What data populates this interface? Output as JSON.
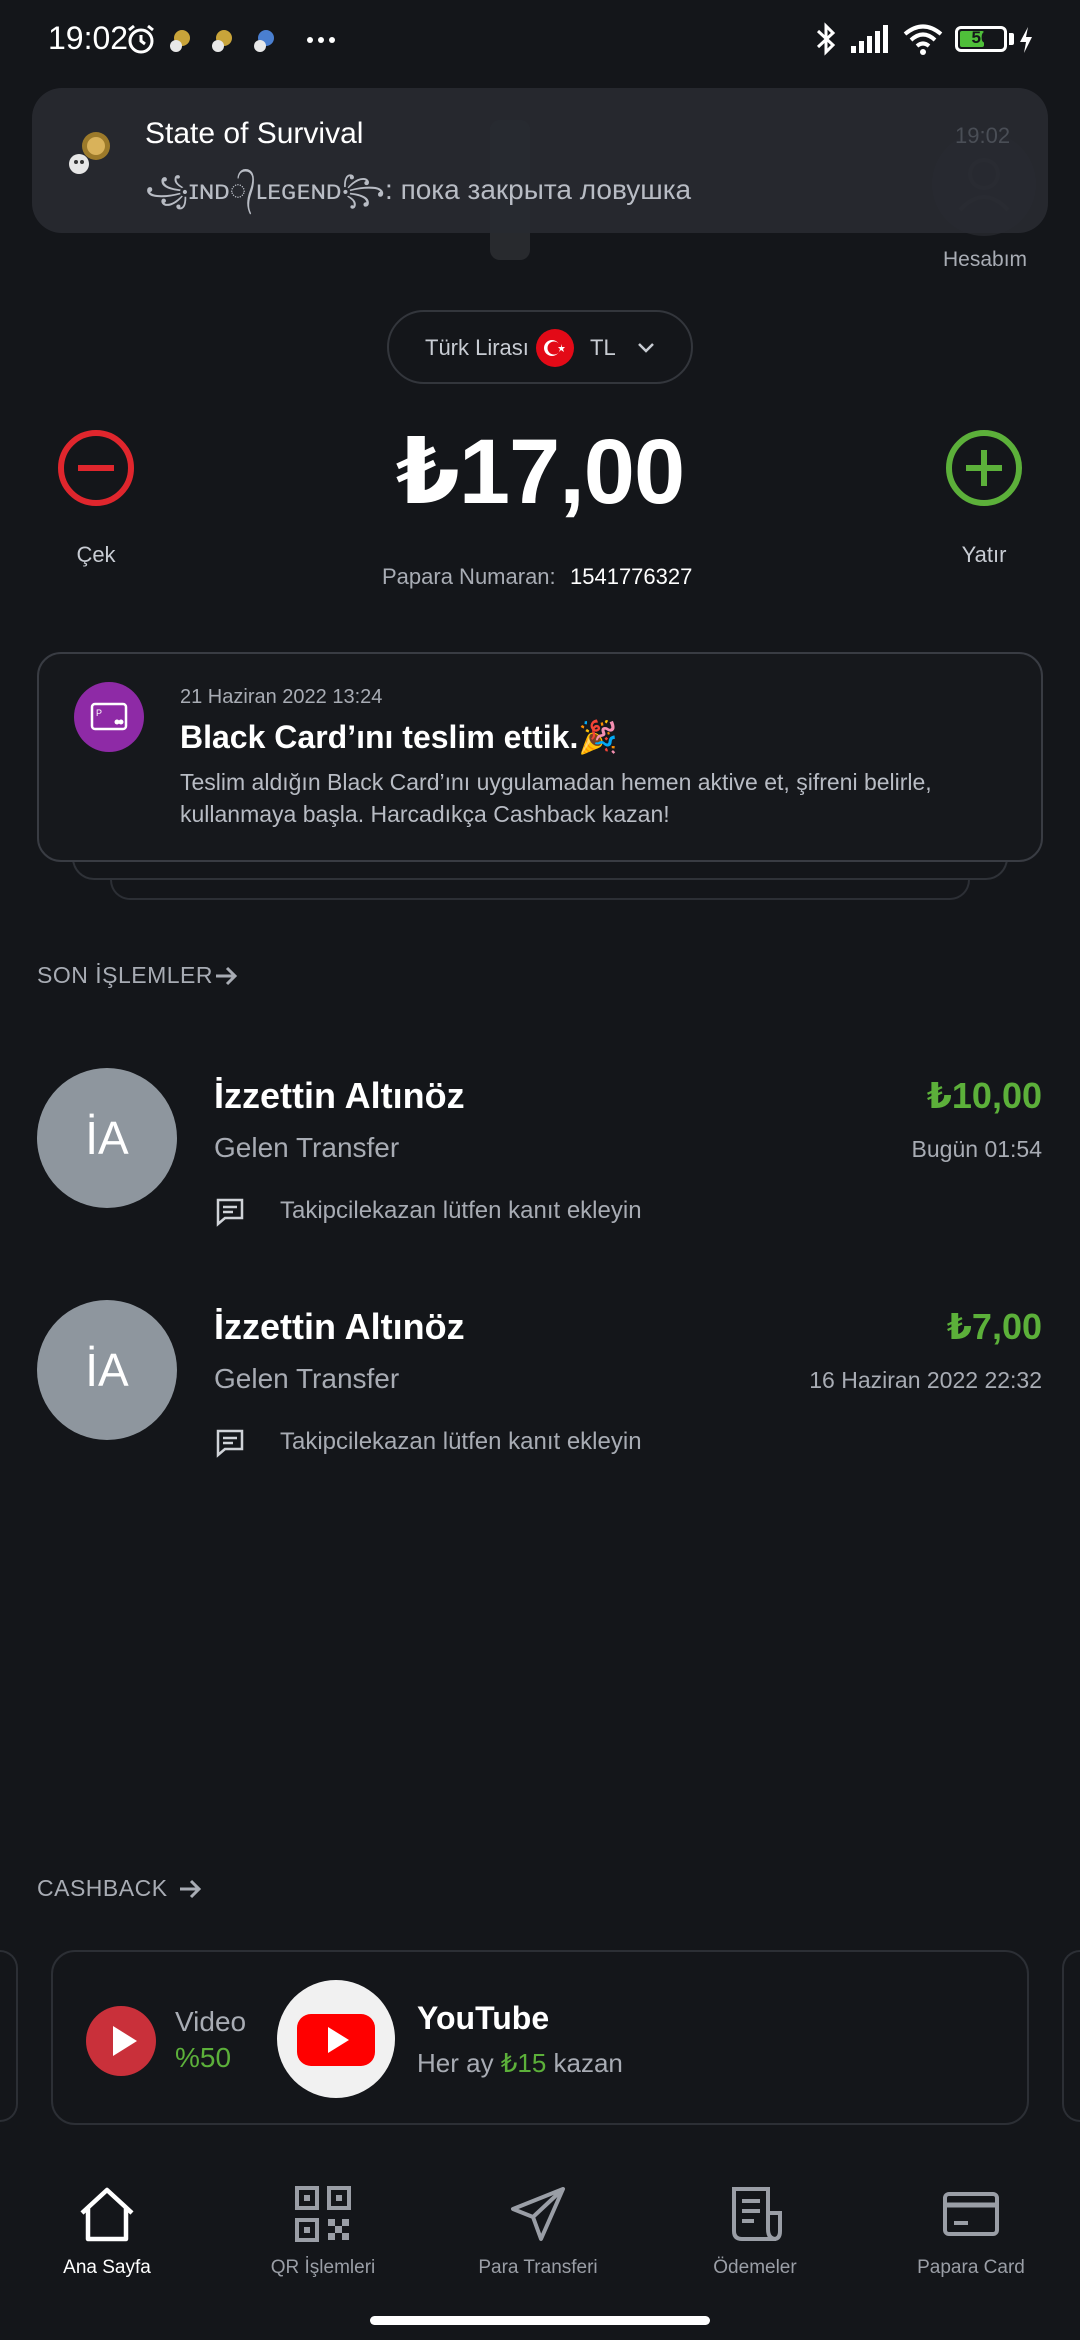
{
  "status_bar": {
    "time": "19:02",
    "battery": "56",
    "battery_level": 0.56,
    "icons": [
      "alarm-icon",
      "app-notification-icon",
      "app-notification-icon",
      "app-notification-icon",
      "more-dots-icon",
      "bluetooth-icon",
      "signal-icon",
      "wifi-icon",
      "battery-icon",
      "charging-icon"
    ]
  },
  "notification": {
    "title": "State of Survival",
    "message": "꧁ɪɴᴅ᭄ʟᴇɢᴇɴᴅ꧂: пока закрыта ловушка",
    "time": "19:02"
  },
  "header": {
    "account_label": "Hesabım"
  },
  "currency": {
    "name": "Türk Lirası",
    "code": "TL"
  },
  "balance": {
    "amount": "₺17,00",
    "withdraw_label": "Çek",
    "deposit_label": "Yatır",
    "papara_number_label": "Papara Numaran:",
    "papara_number": "1541776327"
  },
  "announcement": {
    "date": "21 Haziran 2022 13:24",
    "title": "Black Card’ını teslim ettik.🎉",
    "body": "Teslim aldığın Black Card’ını uygulamadan hemen aktive et, şifreni belirle, kullanmaya başla. Harcadıkça Cashback kazan!"
  },
  "recent_transactions": {
    "title": "SON İŞLEMLER",
    "items": [
      {
        "initials": "İA",
        "name": "İzzettin Altınöz",
        "type": "Gelen Transfer",
        "amount": "₺10,00",
        "date": "Bugün 01:54",
        "note": "Takipcilekazan lütfen kanıt ekleyin"
      },
      {
        "initials": "İA",
        "name": "İzzettin Altınöz",
        "type": "Gelen Transfer",
        "amount": "₺7,00",
        "date": "16 Haziran 2022 22:32",
        "note": "Takipcilekazan lütfen kanıt ekleyin"
      }
    ]
  },
  "cashback": {
    "title": "CASHBACK",
    "video_label": "Video",
    "video_percent": "%50",
    "brand": "YouTube",
    "offer_prefix": "Her ay",
    "offer_amount": "₺15",
    "offer_suffix": "kazan"
  },
  "bottom_nav": {
    "items": [
      {
        "label": "Ana Sayfa",
        "icon": "home-icon",
        "active": true
      },
      {
        "label": "QR İşlemleri",
        "icon": "qr-icon",
        "active": false
      },
      {
        "label": "Para Transferi",
        "icon": "send-icon",
        "active": false
      },
      {
        "label": "Ödemeler",
        "icon": "bill-icon",
        "active": false
      },
      {
        "label": "Papara Card",
        "icon": "card-icon",
        "active": false
      }
    ]
  },
  "colors": {
    "background": "#14161a",
    "positive": "#5cb03a",
    "negative": "#e0262d",
    "card_icon": "#8e2aa6",
    "youtube_red": "#ff0000"
  }
}
